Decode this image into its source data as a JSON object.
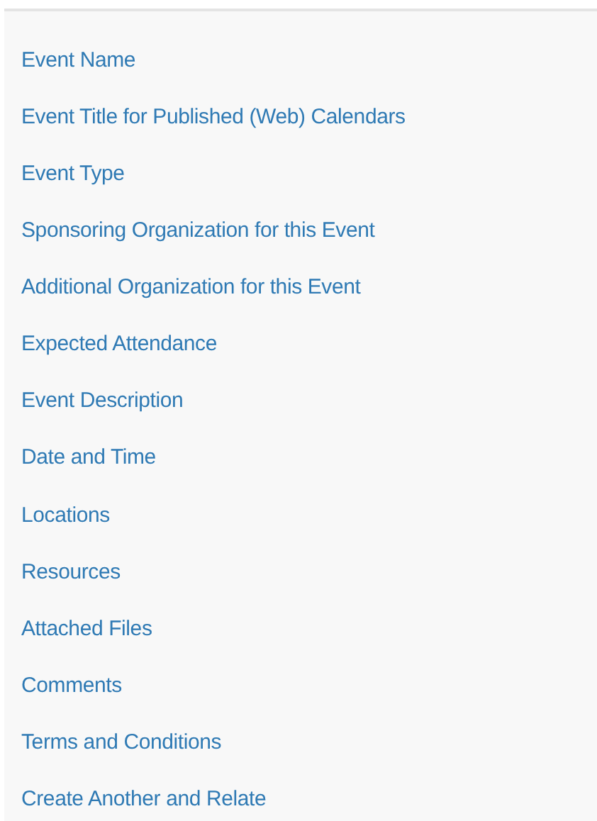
{
  "nav_links": [
    "Event Name",
    "Event Title for Published (Web) Calendars",
    "Event Type",
    "Sponsoring Organization for this Event",
    "Additional Organization for this Event",
    "Expected Attendance",
    "Event Description",
    "Date and Time",
    "Locations",
    "Resources",
    "Attached Files",
    "Comments",
    "Terms and Conditions",
    "Create Another and Relate"
  ]
}
